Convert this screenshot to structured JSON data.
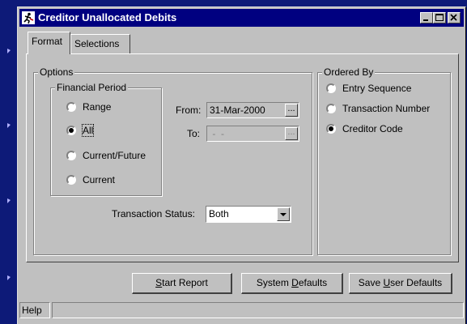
{
  "window": {
    "title": "Creditor Unallocated Debits"
  },
  "tabs": [
    {
      "label": "Format"
    },
    {
      "label": "Selections"
    }
  ],
  "options": {
    "legend": "Options",
    "financial_period": {
      "legend": "Financial Period",
      "radios": [
        {
          "label": "Range",
          "selected": false
        },
        {
          "label": "All",
          "selected": true
        },
        {
          "label": "Current/Future",
          "selected": false
        },
        {
          "label": "Current",
          "selected": false
        }
      ]
    },
    "from_label": "From:",
    "from_value": "31-Mar-2000",
    "to_label": "To:",
    "to_value": " -  - ",
    "browse_glyph": "...",
    "transaction_status_label": "Transaction Status:",
    "transaction_status_value": "Both"
  },
  "ordered_by": {
    "legend": "Ordered By",
    "radios": [
      {
        "label": "Entry Sequence",
        "selected": false
      },
      {
        "label": "Transaction Number",
        "selected": false
      },
      {
        "label": "Creditor Code",
        "selected": true
      }
    ]
  },
  "buttons": {
    "start_report": {
      "pre": "",
      "key": "S",
      "post": "tart Report"
    },
    "system_defaults": {
      "pre": "System ",
      "key": "D",
      "post": "efaults"
    },
    "save_user_defaults": {
      "pre": "Save ",
      "key": "U",
      "post": "ser Defaults"
    }
  },
  "statusbar": {
    "help": "Help"
  }
}
